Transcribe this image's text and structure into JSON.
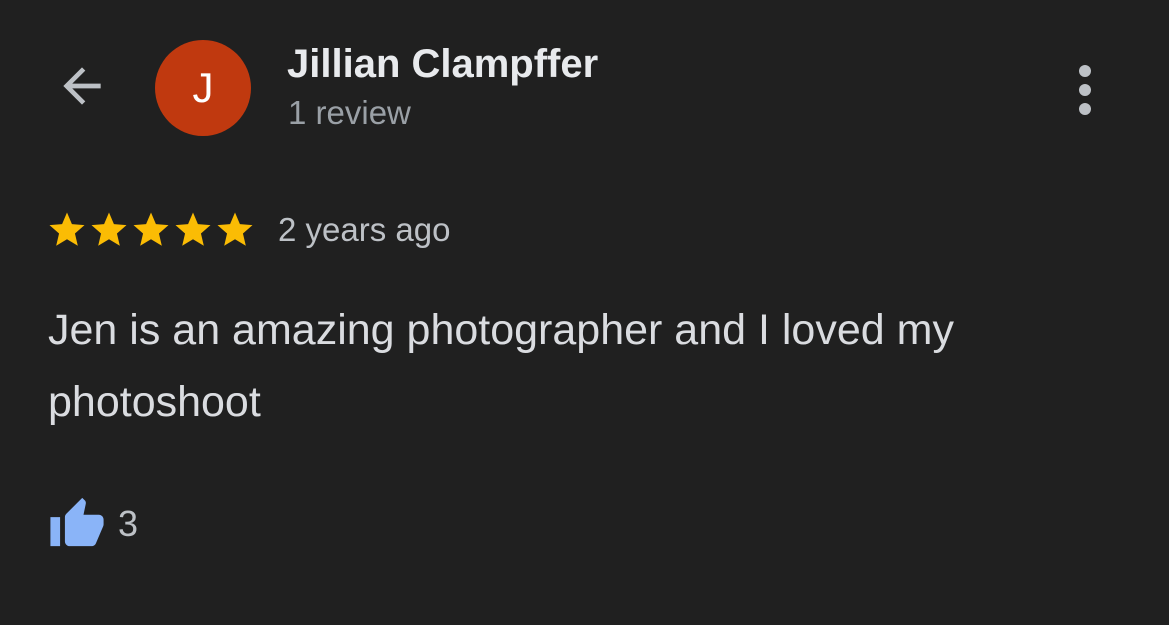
{
  "header": {
    "back_icon": "arrow-left-icon",
    "avatar_letter": "J",
    "avatar_color": "#c0390f",
    "author_name": "Jillian Clampffer",
    "review_count": "1 review",
    "more_icon": "more-vertical-icon"
  },
  "review": {
    "rating": 5,
    "rating_max": 5,
    "star_color": "#fbbc04",
    "time_ago": "2 years ago",
    "text": "Jen is an amazing photographer and I loved my photoshoot"
  },
  "likes": {
    "icon": "thumbs-up-icon",
    "icon_color": "#8ab4f8",
    "count": "3"
  }
}
